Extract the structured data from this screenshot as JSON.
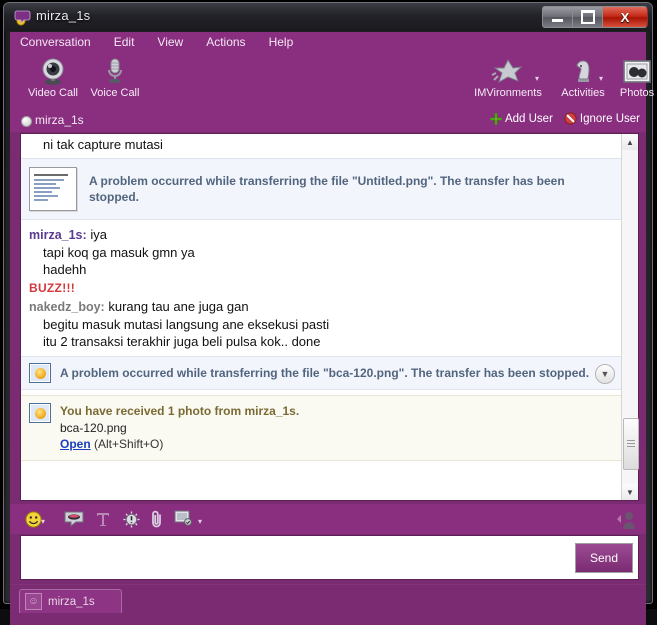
{
  "window": {
    "title": "mirza_1s",
    "app_icon": "yahoo-messenger-icon",
    "minimize": "–",
    "maximize": "□",
    "close": "X"
  },
  "menubar": {
    "items": [
      {
        "label": "Conversation"
      },
      {
        "label": "Edit"
      },
      {
        "label": "View"
      },
      {
        "label": "Actions"
      },
      {
        "label": "Help"
      }
    ]
  },
  "toolbar": {
    "left_buttons": [
      {
        "label": "Video Call",
        "icon": "webcam-icon"
      },
      {
        "label": "Voice Call",
        "icon": "microphone-icon"
      }
    ],
    "right_buttons": [
      {
        "label": "IMVironments",
        "icon": "leaf-icon"
      },
      {
        "label": "Activities",
        "icon": "chess-knight-icon"
      },
      {
        "label": "Photos",
        "icon": "photos-icon"
      }
    ],
    "links": [
      {
        "label": "Add User",
        "icon": "plus-icon"
      },
      {
        "label": "Ignore User",
        "icon": "block-icon"
      }
    ]
  },
  "contact": {
    "name": "mirza_1s",
    "status": "online"
  },
  "conversation": {
    "entries": [
      {
        "type": "text",
        "sender": "",
        "lines": [
          "ni tak capture mutasi"
        ]
      },
      {
        "type": "notice",
        "style": "file-error",
        "icon": "file-document-icon",
        "text": "A problem occurred while transferring the file \"Untitled.png\". The transfer has been stopped."
      },
      {
        "type": "text",
        "sender": "mirza_1s:",
        "sender_side": "them",
        "lines": [
          "iya",
          "tapi koq ga masuk gmn ya",
          "hadehh"
        ]
      },
      {
        "type": "buzz",
        "text": "BUZZ!!!"
      },
      {
        "type": "text",
        "sender": "nakedz_boy:",
        "sender_side": "me",
        "lines": [
          "kurang tau ane juga gan",
          "begitu masuk mutasi langsung ane eksekusi pasti",
          "itu 2 transaksi terakhir juga beli pulsa kok.. done"
        ]
      },
      {
        "type": "notice",
        "style": "file-error",
        "icon": "photo-icon",
        "text": "A problem occurred while transferring the file \"bca-120.png\". The transfer has been stopped.",
        "has_chevron": true,
        "chevron_icon": "chevron-down-icon"
      },
      {
        "type": "notice",
        "style": "photo-received",
        "icon": "photo-icon",
        "text": "You have received 1 photo from mirza_1s.",
        "filename": "bca-120.png",
        "action_label": "Open",
        "action_hint": "(Alt+Shift+O)"
      }
    ]
  },
  "compose": {
    "tools": [
      {
        "icon": "smiley-icon",
        "name": "emoticons"
      },
      {
        "icon": "audibles-icon",
        "name": "audibles"
      },
      {
        "icon": "text-format-icon",
        "name": "font"
      },
      {
        "icon": "buzz-icon",
        "name": "buzz"
      },
      {
        "icon": "paperclip-icon",
        "name": "attach-file"
      },
      {
        "icon": "share-photo-icon",
        "name": "share-photo"
      }
    ],
    "avatar_icon": "avatar-icon",
    "input_value": "",
    "input_placeholder": "",
    "send_label": "Send"
  },
  "tabs": [
    {
      "label": "mirza_1s",
      "icon": "smiley-tab-icon",
      "active": true
    }
  ],
  "colors": {
    "purple": "#8a2f80",
    "purple_dark": "#7b2b72",
    "notice_blue": "#52657f",
    "notice_gold": "#7a6a34",
    "buzz_red": "#d2383c",
    "link_blue": "#1b3fbf",
    "sender_them": "#5b3a8f",
    "sender_me": "#7a7a7a"
  }
}
